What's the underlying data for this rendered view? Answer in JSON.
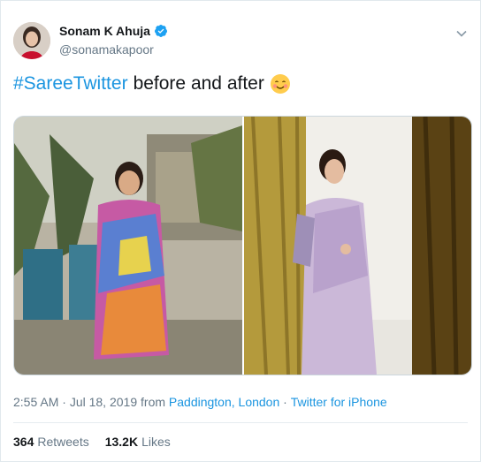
{
  "author": {
    "name": "Sonam K Ahuja",
    "handle": "@sonamakapoor",
    "verified": true
  },
  "tweet": {
    "hashtag": "#SareeTwitter",
    "text": "before and after",
    "emoji": "smiling-face-with-hearts-emoji"
  },
  "media": [
    {
      "description_icon": "photo-left"
    },
    {
      "description_icon": "photo-right"
    }
  ],
  "meta": {
    "time": "2:55 AM",
    "date_sep": " · ",
    "date": "Jul 18, 2019",
    "from": " from ",
    "location": "Paddington, London",
    "client_sep": " · ",
    "client": "Twitter for iPhone"
  },
  "stats": {
    "retweets_count": "364",
    "retweets_label": "Retweets",
    "likes_count": "13.2K",
    "likes_label": "Likes"
  },
  "colors": {
    "link": "#1b95e0",
    "muted": "#657786",
    "text": "#14171a"
  }
}
